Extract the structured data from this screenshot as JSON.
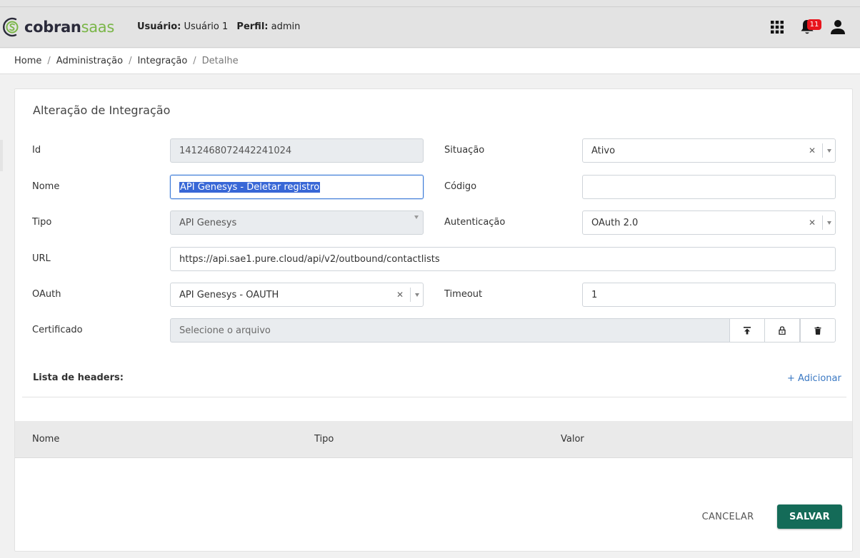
{
  "app": {
    "logo_main": "cobran",
    "logo_accent": "saas"
  },
  "header": {
    "user_label": "Usuário:",
    "user_value": "Usuário 1",
    "profile_label": "Perfil:",
    "profile_value": "admin",
    "notification_count": "11",
    "icons": [
      "apps-grid-icon",
      "bell-icon",
      "user-icon"
    ]
  },
  "breadcrumb": [
    "Home",
    "Administração",
    "Integração",
    "Detalhe"
  ],
  "form": {
    "title": "Alteração de Integração",
    "id": {
      "label": "Id",
      "value": "1412468072442241024"
    },
    "situacao": {
      "label": "Situação",
      "value": "Ativo"
    },
    "nome": {
      "label": "Nome",
      "value": "API Genesys - Deletar registro"
    },
    "codigo": {
      "label": "Código",
      "value": ""
    },
    "tipo": {
      "label": "Tipo",
      "value": "API Genesys"
    },
    "autenticacao": {
      "label": "Autenticação",
      "value": "OAuth 2.0"
    },
    "url": {
      "label": "URL",
      "value": "https://api.sae1.pure.cloud/api/v2/outbound/contactlists"
    },
    "oauth": {
      "label": "OAuth",
      "value": "API Genesys - OAUTH"
    },
    "timeout": {
      "label": "Timeout",
      "value": "1"
    },
    "certificado": {
      "label": "Certificado",
      "placeholder": "Selecione o arquivo"
    }
  },
  "headers_list": {
    "label": "Lista de headers:",
    "add_label": "+ Adicionar",
    "columns": [
      "Nome",
      "Tipo",
      "Valor"
    ],
    "rows": []
  },
  "actions": {
    "cancel": "CANCELAR",
    "save": "SALVAR"
  },
  "colors": {
    "primary": "#146b58",
    "accent": "#7ab648",
    "link": "#3a78c3",
    "badge": "#e8141c",
    "focus": "#3d7bd8"
  }
}
